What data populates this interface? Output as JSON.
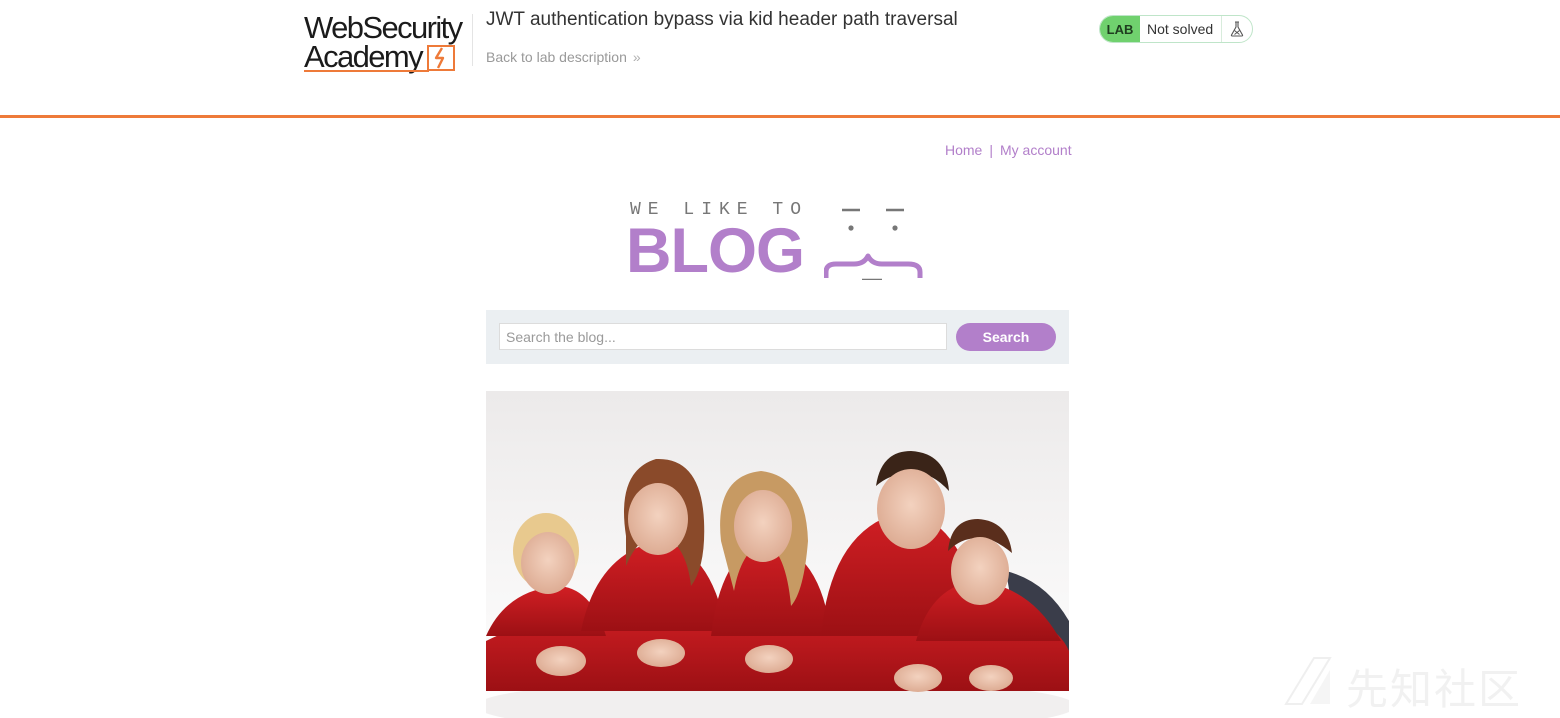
{
  "academy": {
    "logo_line1": "WebSecurity",
    "logo_line2": "Academy",
    "lab_title": "JWT authentication bypass via kid header path traversal",
    "back_link": "Back to lab description",
    "back_chevron": "»",
    "status": {
      "badge": "LAB",
      "text": "Not solved",
      "badge_color": "#70d16e"
    },
    "accent_color": "#ee7a39"
  },
  "blog": {
    "nav": {
      "home": "Home",
      "separator": "|",
      "my_account": "My account"
    },
    "logo": {
      "tagline": "WE LIKE TO",
      "word": "BLOG"
    },
    "brand_color": "#b27fca",
    "search": {
      "placeholder": "Search the blog...",
      "button": "Search"
    },
    "post": {
      "image_icon": "family-photo"
    }
  },
  "watermark": {
    "text": "先知社区"
  }
}
